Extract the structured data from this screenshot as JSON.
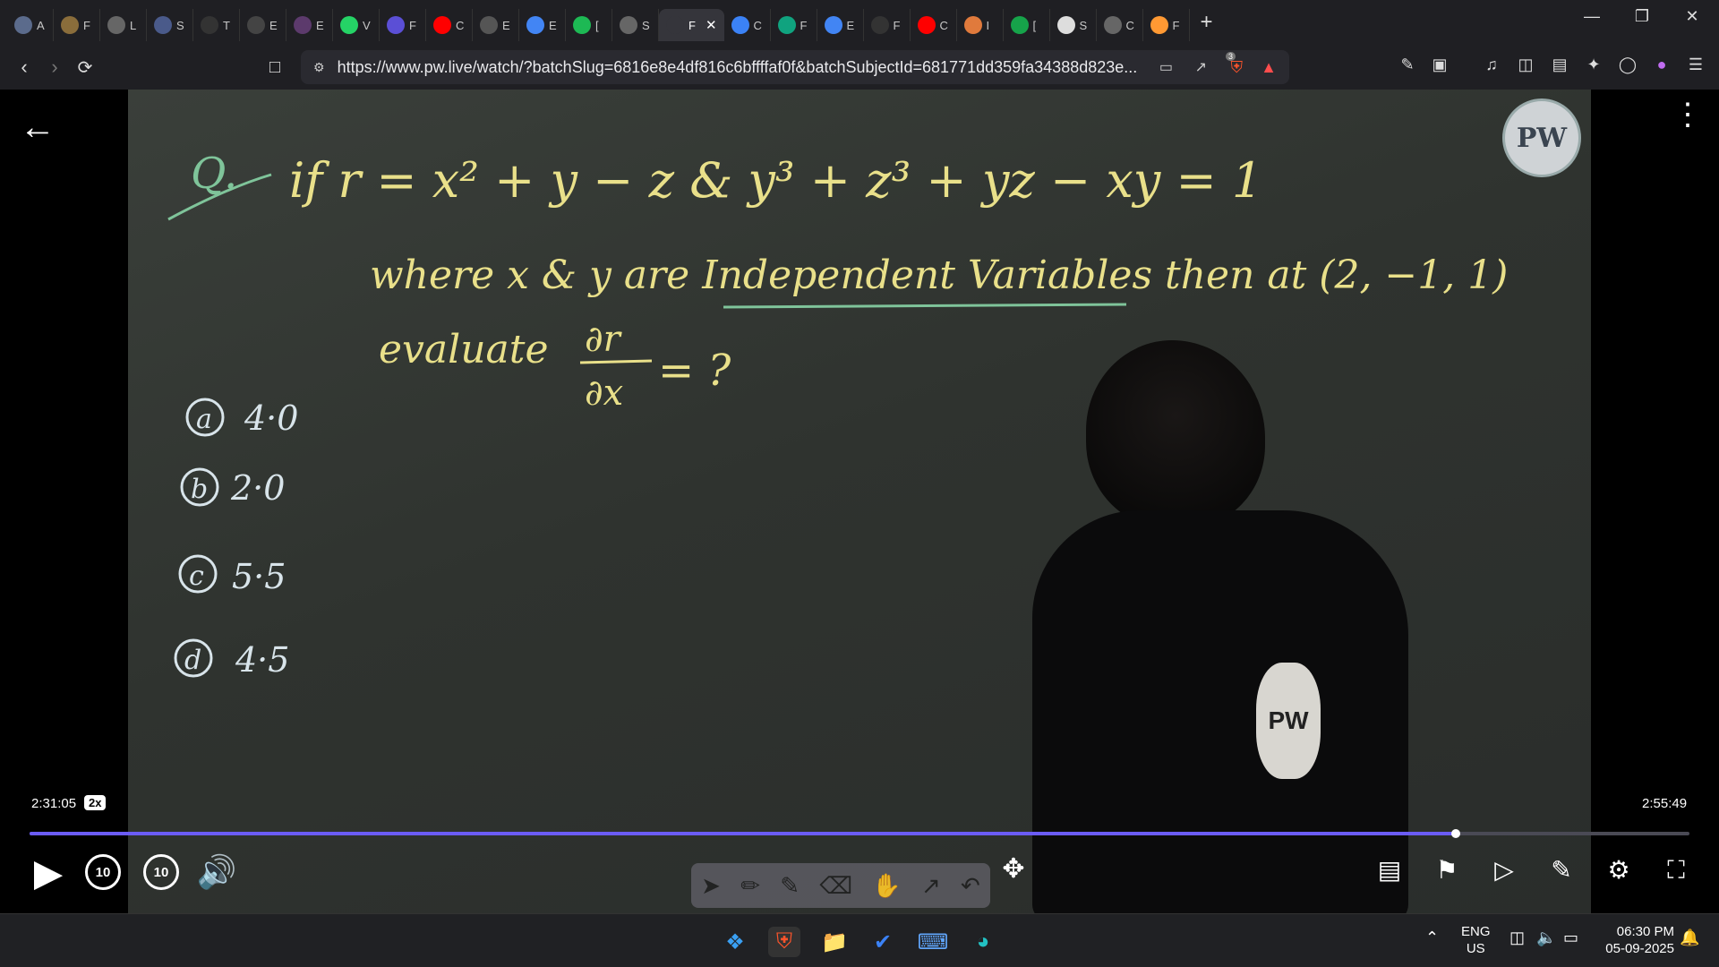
{
  "browser": {
    "tabs": [
      {
        "icon": "circle-app-icon",
        "title": "A",
        "color": "#5b6b8c"
      },
      {
        "icon": "compass-icon",
        "title": "F",
        "color": "#8a6d3b"
      },
      {
        "icon": "globe-icon",
        "title": "L",
        "color": "#666"
      },
      {
        "icon": "grid-icon",
        "title": "S",
        "color": "#4a5a8a"
      },
      {
        "icon": "w3-icon",
        "title": "T",
        "color": "#333"
      },
      {
        "icon": "box-icon",
        "title": "E",
        "color": "#444"
      },
      {
        "icon": "planet-icon",
        "title": "E",
        "color": "#5c3a6c"
      },
      {
        "icon": "whatsapp-icon",
        "title": "V",
        "color": "#25d366"
      },
      {
        "icon": "flag-icon",
        "title": "F",
        "color": "#5b4fd6"
      },
      {
        "icon": "youtube-icon",
        "title": "C",
        "color": "#ff0000"
      },
      {
        "icon": "orkut-icon",
        "title": "E",
        "color": "#555"
      },
      {
        "icon": "google-icon",
        "title": "E",
        "color": "#4285f4"
      },
      {
        "icon": "spotify-icon",
        "title": "[",
        "color": "#1db954"
      },
      {
        "icon": "globe-icon",
        "title": "S",
        "color": "#666"
      },
      {
        "icon": "page-icon",
        "title": "F",
        "color": "#35353b",
        "active": true
      },
      {
        "icon": "gemini-icon",
        "title": "C",
        "color": "#3b82f6"
      },
      {
        "icon": "chatgpt-icon",
        "title": "F",
        "color": "#10a37f"
      },
      {
        "icon": "google-icon",
        "title": "E",
        "color": "#4285f4"
      },
      {
        "icon": "monitor-icon",
        "title": "F",
        "color": "#333"
      },
      {
        "icon": "youtube-icon",
        "title": "C",
        "color": "#ff0000"
      },
      {
        "icon": "burger-icon",
        "title": "I",
        "color": "#e07a3c"
      },
      {
        "icon": "chart-icon",
        "title": "[",
        "color": "#16a34a"
      },
      {
        "icon": "wikipedia-icon",
        "title": "S",
        "color": "#ddd"
      },
      {
        "icon": "globe-icon",
        "title": "C",
        "color": "#666"
      },
      {
        "icon": "india-flag-icon",
        "title": "F",
        "color": "#ff9933"
      }
    ],
    "new_tab": "+",
    "url": "https://www.pw.live/watch/?batchSlug=6816e8e4df816c6bffffaf0f&batchSubjectId=681771dd359fa34388d823e...",
    "brave_badge": "3"
  },
  "lecture": {
    "question_label": "Q.",
    "line1": "if r = x² + y − z  &  y³ + z³ + yz − xy = 1",
    "line2_a": "where x & y are ",
    "line2_underlined": "Independent Variables",
    "line2_b": " then at (2, −1, 1)",
    "line3_a": "evaluate",
    "fraction_top": "∂r",
    "fraction_bottom": "∂x",
    "line3_b": "= ?",
    "options": [
      {
        "key": "a",
        "value": "4·0"
      },
      {
        "key": "b",
        "value": "2·0"
      },
      {
        "key": "c",
        "value": "5·5"
      },
      {
        "key": "d",
        "value": "4·5"
      }
    ],
    "logo_text": "PW",
    "shirt_logo_text": "PW"
  },
  "player": {
    "current_time": "2:31:05",
    "speed": "2x",
    "duration": "2:55:49",
    "progress": 0.859,
    "skip_back": "10",
    "skip_forward": "10",
    "colors": {
      "progress": "#6b5cf6",
      "track": "#4a4a55"
    }
  },
  "taskbar": {
    "lang_top": "ENG",
    "lang_bottom": "US",
    "time": "06:30 PM",
    "date": "05-09-2025"
  }
}
